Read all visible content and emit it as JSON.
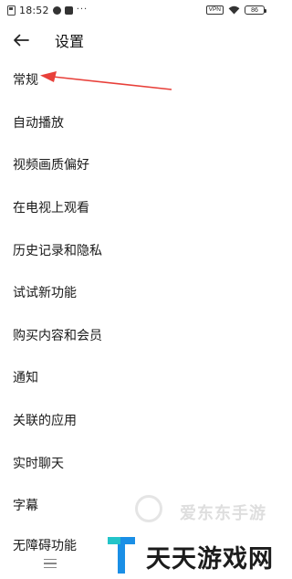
{
  "status_bar": {
    "time": "18:52",
    "more": "···",
    "vpn": "VPN",
    "battery": "86"
  },
  "header": {
    "title": "设置"
  },
  "settings": {
    "items": [
      {
        "label": "常规"
      },
      {
        "label": "自动播放"
      },
      {
        "label": "视频画质偏好"
      },
      {
        "label": "在电视上观看"
      },
      {
        "label": "历史记录和隐私"
      },
      {
        "label": "试试新功能"
      },
      {
        "label": "购买内容和会员"
      },
      {
        "label": "通知"
      },
      {
        "label": "关联的应用"
      },
      {
        "label": "实时聊天"
      },
      {
        "label": "字幕"
      },
      {
        "label": "无障碍功能"
      }
    ]
  },
  "watermark": {
    "faint_text": "爱东东手游",
    "brand_text": "天天游戏网"
  },
  "colors": {
    "annotation_arrow": "#e8403a",
    "brand_blue": "#1a8fe6",
    "brand_teal": "#23c4c9"
  },
  "icons": {
    "back": "arrow-left-icon",
    "menu": "hamburger-icon"
  }
}
